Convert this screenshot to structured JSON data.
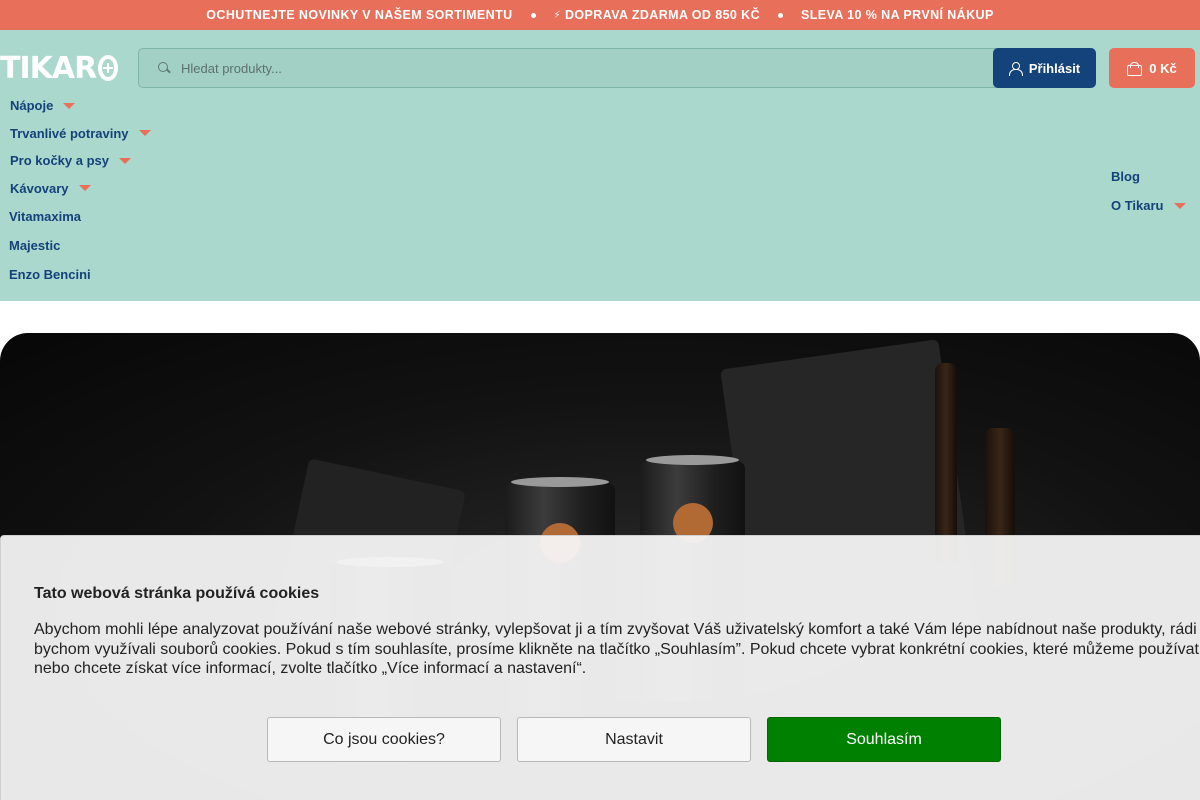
{
  "promo_bar": {
    "items": [
      "OCHUTNEJTE NOVINKY V NAŠEM SORTIMENTU",
      "DOPRAVA ZDARMA OD 850 KČ",
      "SLEVA 10 % NA PRVNÍ NÁKUP"
    ],
    "background": "#e8705a"
  },
  "header": {
    "logo_text": "TIKAR",
    "search": {
      "placeholder": "Hledat produkty...",
      "value": ""
    },
    "login_label": "Přihlásit",
    "cart_label": "0 Kč",
    "colors": {
      "background": "#abd8cc",
      "primary": "#14427a",
      "accent": "#e8705a"
    }
  },
  "nav": {
    "left": [
      {
        "label": "Nápoje",
        "has_dropdown": true
      },
      {
        "label": "Trvanlivé potraviny",
        "has_dropdown": true
      },
      {
        "label": "Pro kočky a psy",
        "has_dropdown": true
      },
      {
        "label": "Kávovary",
        "has_dropdown": true
      },
      {
        "label": "Vitamaxima",
        "has_dropdown": false
      },
      {
        "label": "Majestic",
        "has_dropdown": false
      },
      {
        "label": "Enzo Bencini",
        "has_dropdown": false
      }
    ],
    "right": [
      {
        "label": "Blog",
        "has_dropdown": false
      },
      {
        "label": "O Tikaru",
        "has_dropdown": true
      }
    ]
  },
  "cookie_banner": {
    "title": "Tato webová stránka používá cookies",
    "text": "Abychom mohli lépe analyzovat používání naše webové stránky, vylepšovat ji a tím zvyšovat Váš uživatelský komfort a také Vám lépe nabídnout naše produkty, rádi bychom využívali souborů cookies. Pokud s tím souhlasíte, prosíme klikněte na tlačítko „Souhlasím”. Pokud chcete vybrat konkrétní cookies, které můžeme používat, nebo chcete získat více informací, zvolte tlačítko „Více informací a nastavení“.",
    "buttons": {
      "info": "Co jsou cookies?",
      "settings": "Nastavit",
      "accept": "Souhlasím"
    },
    "accept_color": "#008000"
  }
}
